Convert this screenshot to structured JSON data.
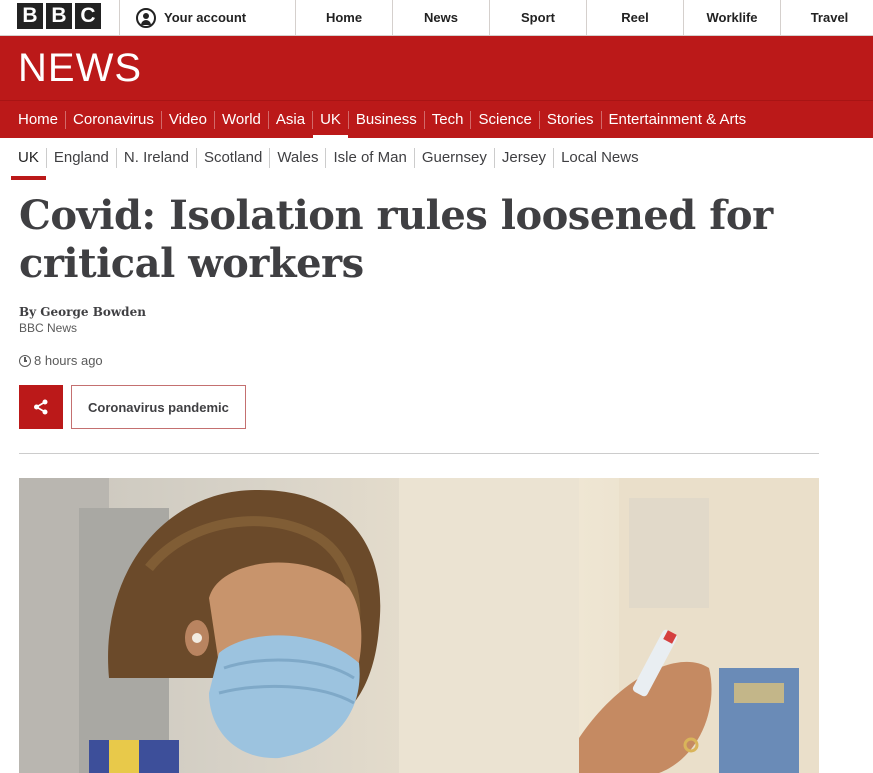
{
  "top_bar": {
    "logo_letters": [
      "B",
      "B",
      "C"
    ],
    "account_label": "Your account",
    "nav": [
      "Home",
      "News",
      "Sport",
      "Reel",
      "Worklife",
      "Travel"
    ]
  },
  "masthead": {
    "title": "NEWS"
  },
  "section_nav": {
    "items": [
      "Home",
      "Coronavirus",
      "Video",
      "World",
      "Asia",
      "UK",
      "Business",
      "Tech",
      "Science",
      "Stories",
      "Entertainment & Arts"
    ],
    "active": "UK"
  },
  "sub_nav": {
    "items": [
      "UK",
      "England",
      "N. Ireland",
      "Scotland",
      "Wales",
      "Isle of Man",
      "Guernsey",
      "Jersey",
      "Local News"
    ],
    "active": "UK"
  },
  "article": {
    "headline": "Covid: Isolation rules loosened for critical workers",
    "byline_name": "By George Bowden",
    "byline_org": "BBC News",
    "timestamp": "8 hours ago",
    "topic_label": "Coronavirus pandemic"
  },
  "colors": {
    "brand_red": "#bb1919",
    "text_dark": "#3f3f42"
  },
  "icons": {
    "account": "user-circle-icon",
    "clock": "clock-icon",
    "share": "share-icon"
  }
}
